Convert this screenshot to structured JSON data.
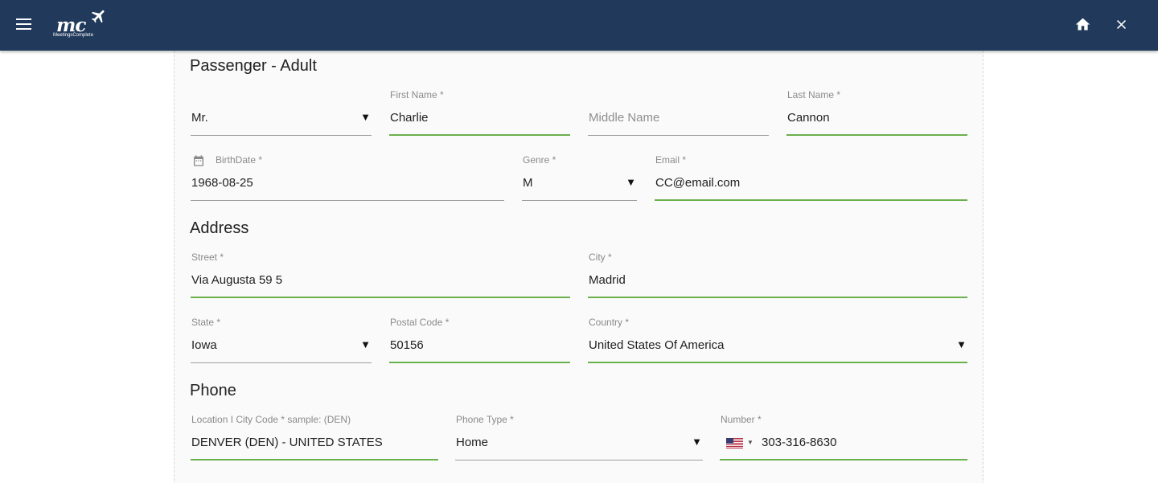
{
  "app": {
    "logo_text": "mc",
    "logo_subtext": "MeetingsComplete",
    "icons": {
      "menu": "hamburger-icon",
      "home": "home-icon",
      "close": "close-icon"
    },
    "colors": {
      "header": "#213a5b",
      "valid_underline": "#6ab04c"
    }
  },
  "passenger": {
    "title": "Passenger - Adult",
    "salutation": {
      "value": "Mr."
    },
    "first_name": {
      "label": "First Name *",
      "value": "Charlie"
    },
    "middle_name": {
      "placeholder": "Middle Name"
    },
    "last_name": {
      "label": "Last Name *",
      "value": "Cannon"
    },
    "birthdate": {
      "label": "BirthDate *",
      "value": "1968-08-25"
    },
    "genre": {
      "label": "Genre *",
      "value": "M"
    },
    "email": {
      "label": "Email *",
      "value": "CC@email.com"
    }
  },
  "address": {
    "title": "Address",
    "street": {
      "label": "Street *",
      "value": "Via Augusta 59 5"
    },
    "city": {
      "label": "City *",
      "value": "Madrid"
    },
    "state": {
      "label": "State *",
      "value": "Iowa"
    },
    "postal_code": {
      "label": "Postal Code *",
      "value": "50156"
    },
    "country": {
      "label": "Country *",
      "value": "United States Of America"
    }
  },
  "phone": {
    "title": "Phone",
    "location": {
      "label": "Location I City Code * sample: (DEN)",
      "value": "DENVER (DEN) - UNITED STATES"
    },
    "phone_type": {
      "label": "Phone Type *",
      "value": "Home"
    },
    "number": {
      "label": "Number *",
      "value": "303-316-8630"
    }
  }
}
